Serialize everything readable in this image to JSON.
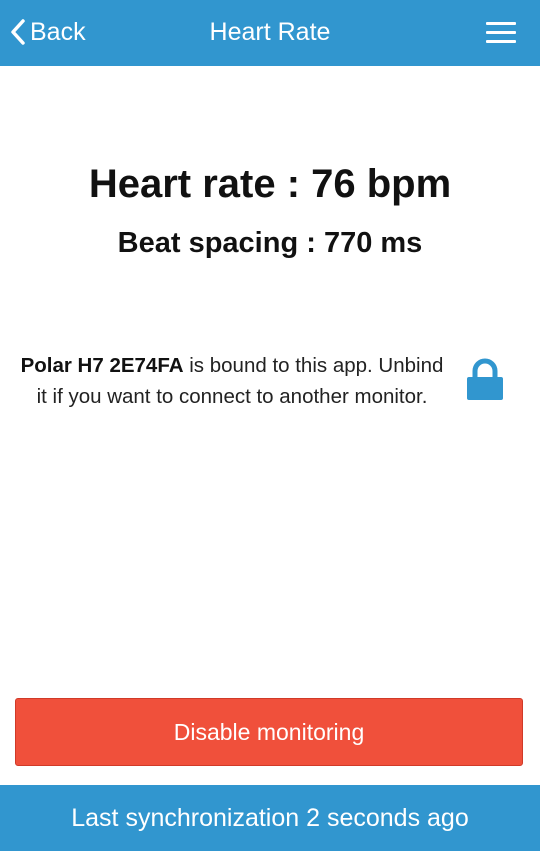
{
  "header": {
    "back_label": "Back",
    "title": "Heart Rate",
    "back_icon": "chevron-left-icon",
    "menu_icon": "hamburger-menu-icon"
  },
  "readings": {
    "heart_rate": "Heart rate : 76 bpm",
    "beat_spacing": "Beat spacing : 770 ms"
  },
  "binding": {
    "device_name": "Polar H7 2E74FA",
    "message": " is bound to this app. Unbind it if you want to connect to another monitor.",
    "lock_icon": "lock-icon"
  },
  "actions": {
    "disable_label": "Disable monitoring"
  },
  "status": {
    "sync_text": "Last synchronization 2 seconds ago"
  },
  "colors": {
    "primary": "#3196cf",
    "danger": "#f0503b"
  }
}
